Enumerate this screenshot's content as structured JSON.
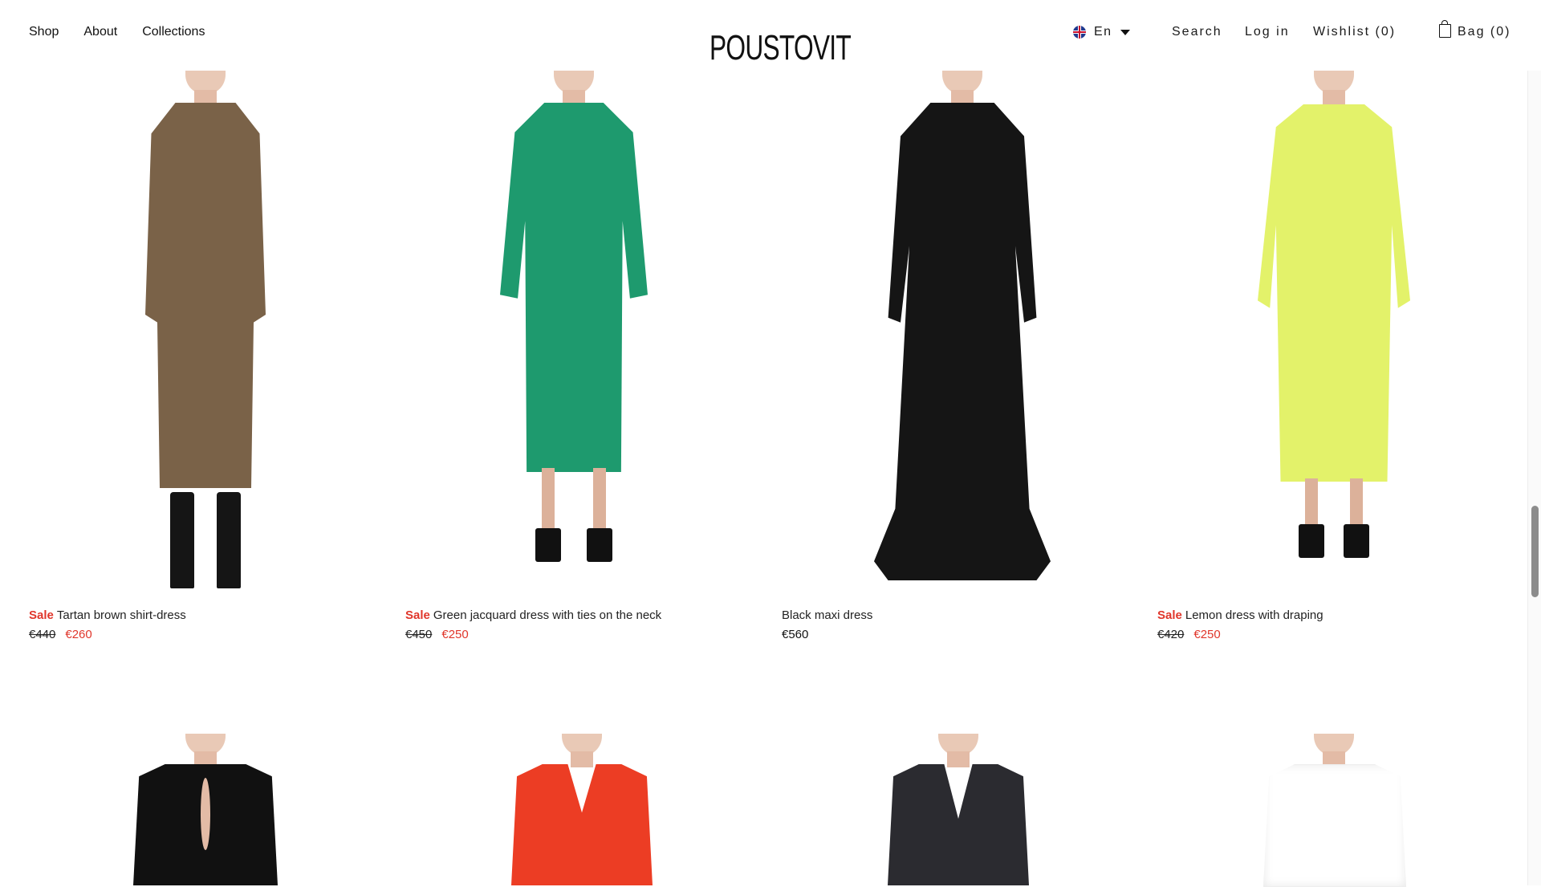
{
  "nav": {
    "shop": "Shop",
    "about": "About",
    "collections": "Collections"
  },
  "brand": "POUSTOVIT",
  "header": {
    "language": "En",
    "search": "Search",
    "login": "Log in",
    "wishlist": "Wishlist (0)",
    "bag": "Bag (0)"
  },
  "products": [
    {
      "sale_label": "Sale",
      "name": "Tartan brown shirt-dress",
      "old_price": "€440",
      "price": "€260",
      "color": "#7a6248"
    },
    {
      "sale_label": "Sale",
      "name": "Green jacquard dress with ties on the neck",
      "old_price": "€450",
      "price": "€250",
      "color": "#1e9a6e"
    },
    {
      "sale_label": "",
      "name": "Black maxi dress",
      "old_price": "",
      "price": "€560",
      "color": "#151515"
    },
    {
      "sale_label": "Sale",
      "name": "Lemon dress with draping",
      "old_price": "€420",
      "price": "€250",
      "color": "#e3f26a"
    }
  ],
  "row2_colors": [
    "#111111",
    "#ec3d24",
    "#2b2b30",
    "#ffffff"
  ],
  "colors": {
    "sale": "#e0362b",
    "text": "#1a1a1a"
  }
}
